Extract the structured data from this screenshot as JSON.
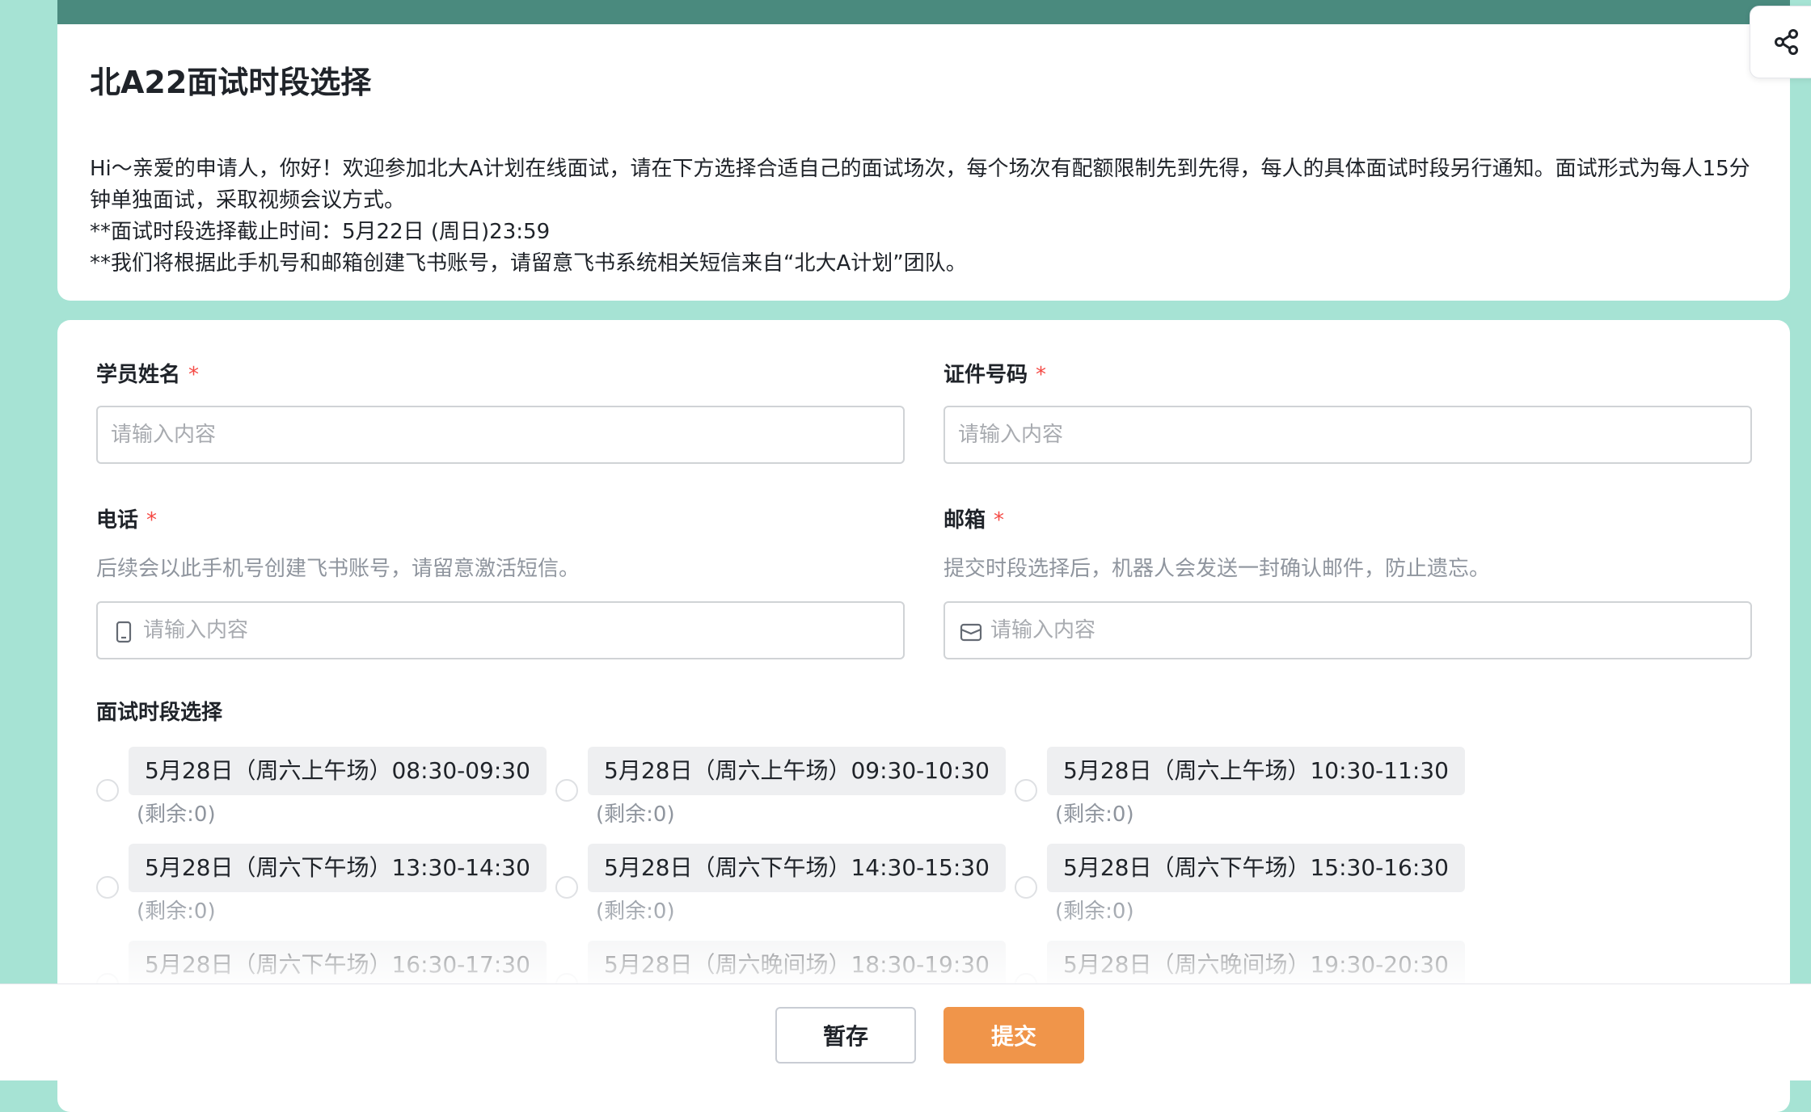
{
  "header": {
    "title": "北A22面试时段选择",
    "description": [
      "Hi～亲爱的申请人，你好！欢迎参加北大A计划在线面试，请在下方选择合适自己的面试场次，每个场次有配额限制先到先得，每人的具体面试时段另行通知。面试形式为每人15分钟单独面试，采取视频会议方式。",
      "**面试时段选择截止时间：5月22日 (周日)23:59",
      "**我们将根据此手机号和邮箱创建飞书账号，请留意飞书系统相关短信来自“北大A计划”团队。"
    ],
    "share_icon": "share-icon"
  },
  "form": {
    "required_mark": "*",
    "name_field": {
      "label": "学员姓名",
      "placeholder": "请输入内容",
      "value": ""
    },
    "id_field": {
      "label": "证件号码",
      "placeholder": "请输入内容",
      "value": ""
    },
    "phone_field": {
      "label": "电话",
      "hint": "后续会以此手机号创建飞书账号，请留意激活短信。",
      "placeholder": "请输入内容",
      "icon": "phone-icon",
      "value": ""
    },
    "email_field": {
      "label": "邮箱",
      "hint": "提交时段选择后，机器人会发送一封确认邮件，防止遗忘。",
      "placeholder": "请输入内容",
      "icon": "mail-icon",
      "value": ""
    },
    "slot_section": {
      "label": "面试时段选择",
      "slots": [
        {
          "label": "5月28日（周六上午场）08:30-09:30",
          "remaining": "(剩余:0)"
        },
        {
          "label": "5月28日（周六上午场）09:30-10:30",
          "remaining": "(剩余:0)"
        },
        {
          "label": "5月28日（周六上午场）10:30-11:30",
          "remaining": "(剩余:0)"
        },
        {
          "label": "5月28日（周六下午场）13:30-14:30",
          "remaining": "(剩余:0)"
        },
        {
          "label": "5月28日（周六下午场）14:30-15:30",
          "remaining": "(剩余:0)"
        },
        {
          "label": "5月28日（周六下午场）15:30-16:30",
          "remaining": "(剩余:0)"
        },
        {
          "label": "5月28日（周六下午场）16:30-17:30",
          "remaining": ""
        },
        {
          "label": "5月28日（周六晚间场）18:30-19:30",
          "remaining": ""
        },
        {
          "label": "5月28日（周六晚间场）19:30-20:30",
          "remaining": ""
        }
      ]
    }
  },
  "footer": {
    "save_label": "暂存",
    "submit_label": "提交",
    "submit_color": "#f0954a"
  }
}
